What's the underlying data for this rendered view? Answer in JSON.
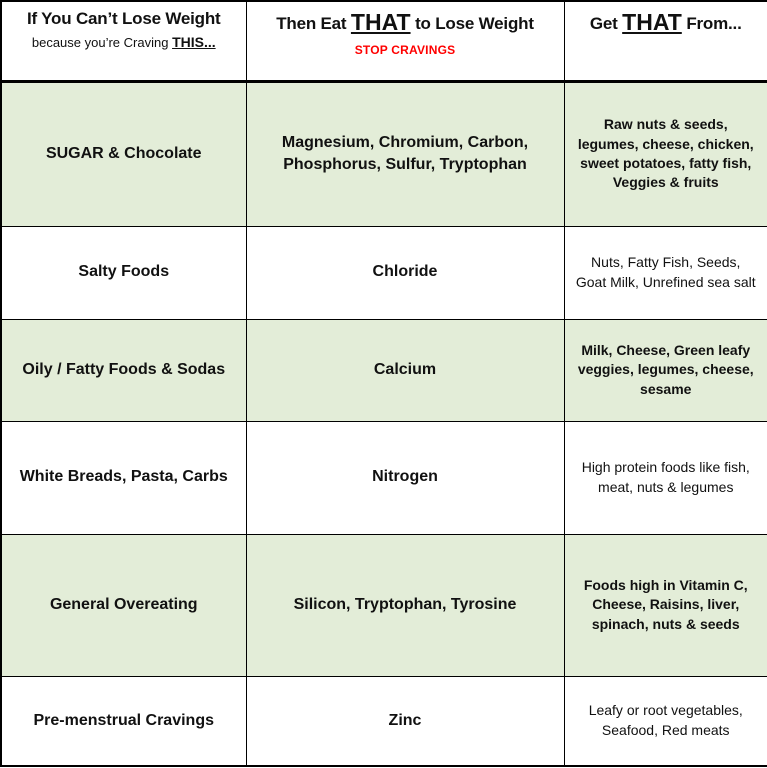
{
  "header": {
    "col1": {
      "line1": "If You Can’t Lose Weight",
      "line2_prefix": "because you’re Craving ",
      "line2_emphasis": "THIS..."
    },
    "col2": {
      "prefix": "Then Eat ",
      "emphasis": "THAT",
      "suffix": " to Lose Weight",
      "subtitle": "STOP CRAVINGS",
      "subtitle_color": "#ff0000"
    },
    "col3": {
      "prefix": "Get ",
      "emphasis": "THAT",
      "suffix": " From..."
    }
  },
  "colors": {
    "shade_row_background": "#e3edd8",
    "plain_row_background": "#ffffff",
    "border": "#000000",
    "text": "#111111",
    "accent_red": "#ff0000"
  },
  "rows": [
    {
      "shaded": true,
      "craving": "SUGAR & Chocolate",
      "eat": "Magnesium, Chromium, Carbon, Phosphorus, Sulfur, Tryptophan",
      "sources": "Raw nuts & seeds, legumes, cheese, chicken, sweet potatoes, fatty fish, Veggies & fruits"
    },
    {
      "shaded": false,
      "craving": "Salty Foods",
      "eat": "Chloride",
      "sources": "Nuts, Fatty Fish, Seeds, Goat Milk, Unrefined sea salt"
    },
    {
      "shaded": true,
      "craving": "Oily / Fatty Foods & Sodas",
      "eat": "Calcium",
      "sources": "Milk, Cheese, Green leafy veggies, legumes, cheese, sesame"
    },
    {
      "shaded": false,
      "craving": "White Breads, Pasta, Carbs",
      "eat": "Nitrogen",
      "sources": "High protein foods like fish, meat, nuts & legumes"
    },
    {
      "shaded": true,
      "craving": "General Overeating",
      "eat": "Silicon, Tryptophan, Tyrosine",
      "sources": "Foods high in Vitamin C, Cheese, Raisins, liver, spinach, nuts & seeds"
    },
    {
      "shaded": false,
      "craving": "Pre-menstrual Cravings",
      "eat": "Zinc",
      "sources": "Leafy or root vegetables, Seafood, Red meats"
    }
  ]
}
